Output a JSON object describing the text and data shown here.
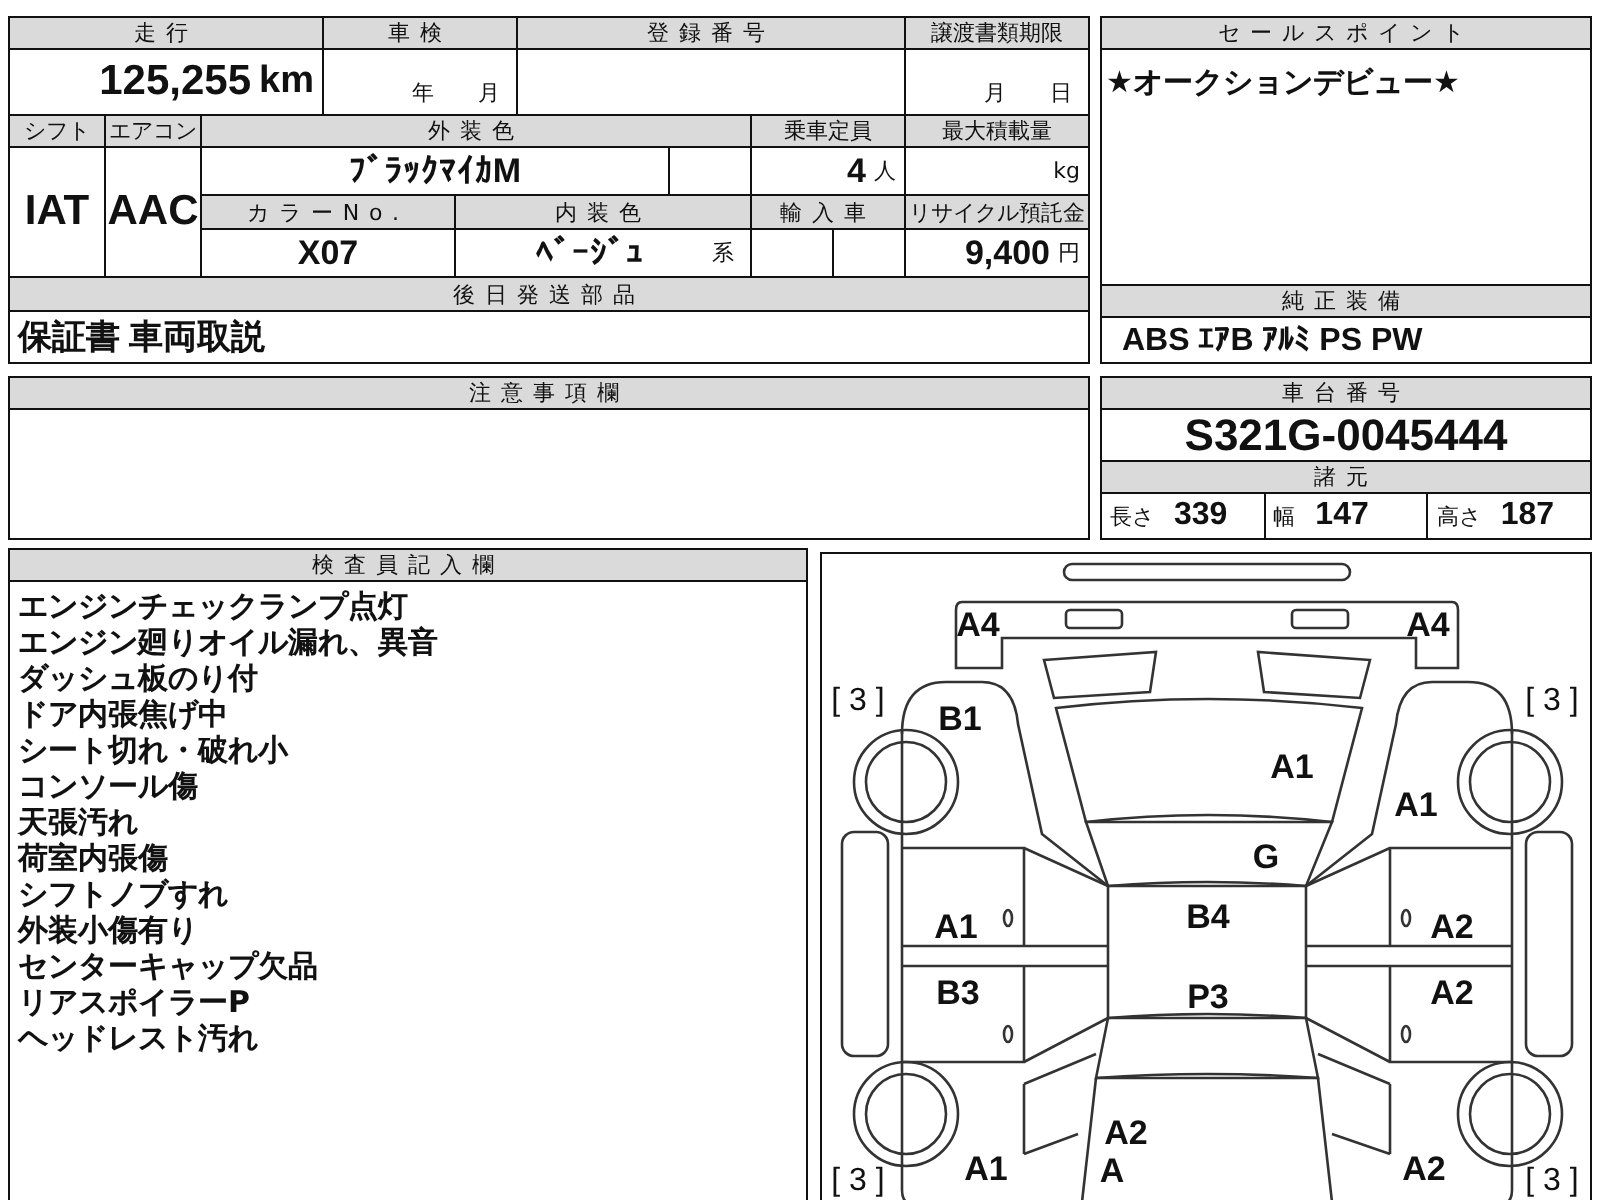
{
  "vehicle_table": {
    "mileage": {
      "label": "走行",
      "value": "125,255",
      "unit": "km"
    },
    "inspection": {
      "label": "車検",
      "year_unit": "年",
      "month_unit": "月"
    },
    "registration_number": {
      "label": "登録番号"
    },
    "transfer_deadline": {
      "label": "譲渡書類期限",
      "month_unit": "月",
      "day_unit": "日"
    },
    "shift": {
      "label": "シフト",
      "value": "IAT"
    },
    "air_conditioner": {
      "label": "エアコン",
      "value": "AAC"
    },
    "exterior_color": {
      "label": "外装色",
      "value": "ﾌﾞﾗｯｸﾏｲｶM"
    },
    "capacity": {
      "label": "乗車定員",
      "value": "4",
      "unit": "人"
    },
    "max_load": {
      "label": "最大積載量",
      "unit": "kg"
    },
    "color_no": {
      "label": "カラーNo.",
      "value": "X07"
    },
    "interior_color": {
      "label": "内装色",
      "value": "ﾍﾞｰｼﾞｭ",
      "suffix": "系"
    },
    "imported": {
      "label": "輸入車"
    },
    "recycling_fee": {
      "label": "リサイクル預託金",
      "value": "9,400",
      "unit": "円"
    },
    "parts_later": {
      "label": "後日発送部品",
      "value": "保証書 車両取説"
    }
  },
  "sales_point": {
    "label": "セールスポイント",
    "text": "★オークションデビュー★"
  },
  "equipment": {
    "label": "純正装備",
    "value": "ABS ｴｱB ｱﾙﾐ PS PW"
  },
  "notes": {
    "label": "注意事項欄"
  },
  "chassis": {
    "label": "車台番号",
    "value": "S321G-0045444"
  },
  "specs": {
    "label": "諸元",
    "items": [
      {
        "label": "長さ",
        "value": "339"
      },
      {
        "label": "幅",
        "value": "147"
      },
      {
        "label": "高さ",
        "value": "187"
      }
    ]
  },
  "inspector": {
    "label": "検査員記入欄",
    "lines": [
      "エンジンチェックランプ点灯",
      "エンジン廻りオイル漏れ、異音",
      "ダッシュ板のり付",
      "ドア内張焦げ中",
      "シート切れ・破れ小",
      "コンソール傷",
      "天張汚れ",
      "荷室内張傷",
      "シフトノブすれ",
      "外装小傷有り",
      "センターキャップ欠品",
      "リアスポイラーP",
      "ヘッドレスト汚れ"
    ]
  },
  "diagram": {
    "marks": [
      {
        "kind": "code",
        "text": "A4"
      },
      {
        "kind": "code",
        "text": "A4"
      },
      {
        "kind": "tire",
        "text": "[ 3 ]"
      },
      {
        "kind": "tire",
        "text": "[ 3 ]"
      },
      {
        "kind": "code",
        "text": "B1"
      },
      {
        "kind": "code",
        "text": "A1"
      },
      {
        "kind": "code",
        "text": "A1"
      },
      {
        "kind": "code",
        "text": "G"
      },
      {
        "kind": "code",
        "text": "A1"
      },
      {
        "kind": "code",
        "text": "B4"
      },
      {
        "kind": "code",
        "text": "A2"
      },
      {
        "kind": "code",
        "text": "B3"
      },
      {
        "kind": "code",
        "text": "P3"
      },
      {
        "kind": "code",
        "text": "A2"
      },
      {
        "kind": "code",
        "text": "A2"
      },
      {
        "kind": "tire",
        "text": "[ 3 ]"
      },
      {
        "kind": "code",
        "text": "A1"
      },
      {
        "kind": "code",
        "text": "A"
      },
      {
        "kind": "code",
        "text": "A2"
      },
      {
        "kind": "tire",
        "text": "[ 3 ]"
      }
    ]
  }
}
